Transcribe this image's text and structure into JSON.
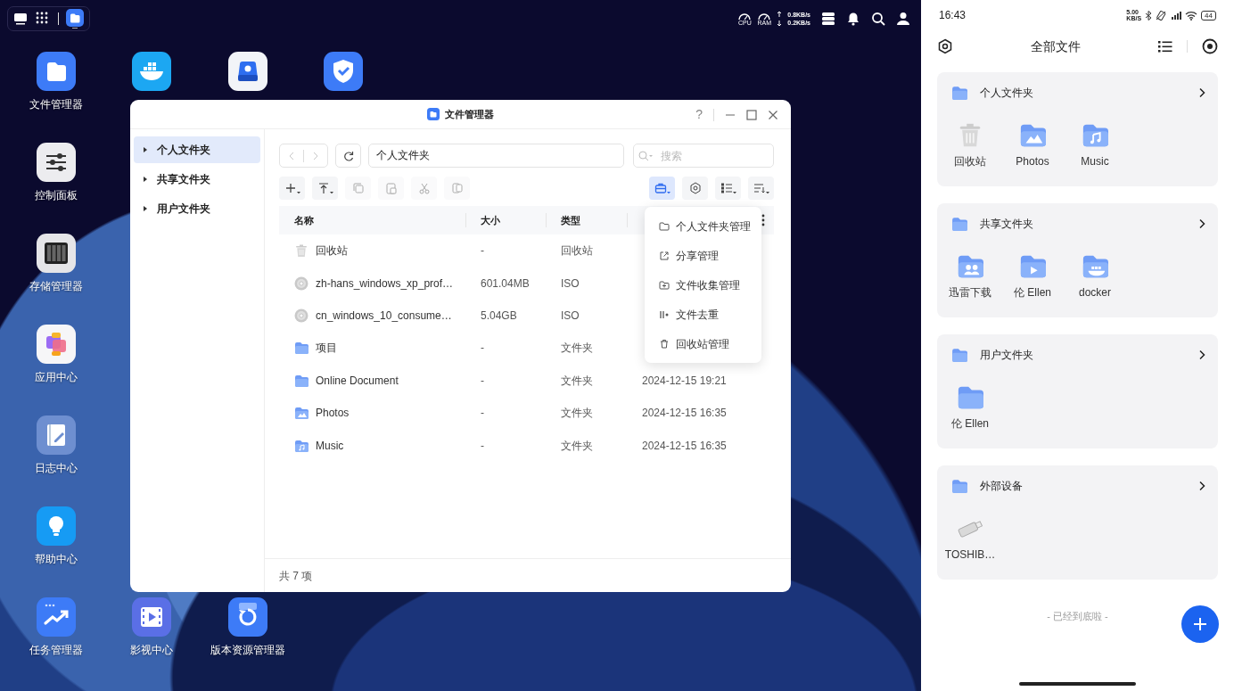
{
  "taskbar": {
    "apps": [
      {
        "kind": "desktop"
      },
      {
        "kind": "launcher"
      },
      {
        "kind": "files",
        "running": true
      }
    ],
    "monitor": {
      "cpu_label": "CPU",
      "ram_label": "RAM",
      "upload": "0.8KB/s",
      "download": "0.2KB/s"
    }
  },
  "desktop_icons": [
    {
      "kind": "files",
      "label": "文件管理器"
    },
    {
      "kind": "docker"
    },
    {
      "kind": "drive"
    },
    {
      "kind": "shield"
    },
    {
      "kind": "control",
      "label": "控制面板"
    },
    {
      "kind": "storage",
      "label": "存储管理器"
    },
    {
      "kind": "appcenter",
      "label": "应用中心"
    },
    {
      "kind": "log",
      "label": "日志中心"
    },
    {
      "kind": "help",
      "label": "帮助中心"
    },
    {
      "kind": "tasks",
      "label": "任务管理器"
    },
    {
      "kind": "video",
      "label": "影视中心"
    },
    {
      "kind": "version",
      "label": "版本资源管理器"
    }
  ],
  "window": {
    "title": "文件管理器",
    "help": "?",
    "sidebar": [
      {
        "label": "个人文件夹",
        "selected": true,
        "expanded": false
      },
      {
        "label": "共享文件夹",
        "selected": false,
        "expanded": false
      },
      {
        "label": "用户文件夹",
        "selected": false,
        "expanded": false
      }
    ],
    "nav": {
      "back_disabled": true,
      "forward_disabled": true,
      "path": "个人文件夹",
      "search_placeholder": "搜索"
    },
    "left_tools": [
      {
        "kind": "new",
        "dropdown": true,
        "disabled": false
      },
      {
        "kind": "upload",
        "dropdown": true,
        "disabled": false
      },
      {
        "kind": "copy",
        "dropdown": false,
        "disabled": true
      },
      {
        "kind": "paste",
        "dropdown": false,
        "disabled": true
      },
      {
        "kind": "cut",
        "dropdown": false,
        "disabled": true
      },
      {
        "kind": "move",
        "dropdown": false,
        "disabled": true
      }
    ],
    "right_tools": [
      {
        "kind": "toolbox",
        "dropdown": true,
        "active": true
      },
      {
        "kind": "settings",
        "dropdown": false,
        "active": false
      },
      {
        "kind": "view",
        "dropdown": true,
        "active": false
      },
      {
        "kind": "sort",
        "dropdown": true,
        "active": false
      }
    ],
    "columns": [
      "名称",
      "大小",
      "类型"
    ],
    "rows": [
      {
        "kind": "trash",
        "name": "回收站",
        "size": "-",
        "type": "回收站"
      },
      {
        "kind": "disc",
        "name": "zh-hans_windows_xp_prof…",
        "size": "601.04MB",
        "type": "ISO"
      },
      {
        "kind": "disc",
        "name": "cn_windows_10_consume…",
        "size": "5.04GB",
        "type": "ISO"
      },
      {
        "kind": "folder",
        "name": "项目",
        "size": "-",
        "type": "文件夹"
      },
      {
        "kind": "folder",
        "name": "Online Document",
        "size": "-",
        "type": "文件夹",
        "modified": "2024-12-15 19:21"
      },
      {
        "kind": "photos",
        "name": "Photos",
        "size": "-",
        "type": "文件夹",
        "modified": "2024-12-15 16:35"
      },
      {
        "kind": "music",
        "name": "Music",
        "size": "-",
        "type": "文件夹",
        "modified": "2024-12-15 16:35"
      }
    ],
    "footer": "共 7 项",
    "menu": [
      {
        "kind": "folder",
        "label": "个人文件夹管理"
      },
      {
        "kind": "share",
        "label": "分享管理"
      },
      {
        "kind": "collect",
        "label": "文件收集管理"
      },
      {
        "kind": "dedupe",
        "label": "文件去重"
      },
      {
        "kind": "trash",
        "label": "回收站管理"
      }
    ]
  },
  "phone": {
    "time": "16:43",
    "net_speed": "5.00",
    "net_unit": "KB/S",
    "battery": "44",
    "title": "全部文件",
    "sections": [
      {
        "title": "个人文件夹",
        "items": [
          {
            "kind": "trash",
            "label": "回收站"
          },
          {
            "kind": "photos",
            "label": "Photos"
          },
          {
            "kind": "music",
            "label": "Music"
          }
        ]
      },
      {
        "title": "共享文件夹",
        "items": [
          {
            "kind": "people",
            "label": "迅雷下载"
          },
          {
            "kind": "video",
            "label": "伦 Ellen"
          },
          {
            "kind": "docker",
            "label": "docker"
          }
        ]
      },
      {
        "title": "用户文件夹",
        "items": [
          {
            "kind": "folder",
            "label": "伦 Ellen"
          }
        ]
      },
      {
        "title": "外部设备",
        "items": [
          {
            "kind": "usb",
            "label": "TOSHIB…"
          }
        ]
      }
    ],
    "end_note": "- 已经到底啦 -"
  }
}
